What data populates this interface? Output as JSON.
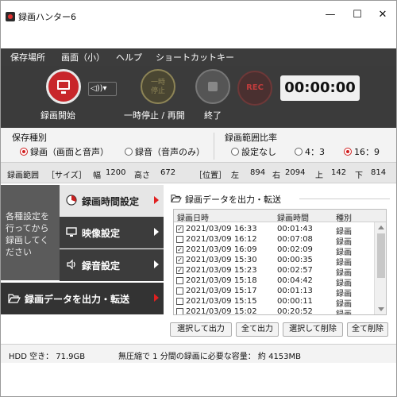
{
  "window": {
    "title": "録画ハンター6",
    "minimize": "—",
    "maximize": "☐",
    "close": "✕"
  },
  "menu": [
    "保存場所",
    "画面（小）",
    "ヘルプ",
    "ショートカットキー"
  ],
  "toolbar": {
    "record_label": "録画開始",
    "speaker": "◁))▾",
    "pause_icon_text": "一時\n停止",
    "pause_label": "一時停止 / 再開",
    "stop_label": "終了",
    "rec_text": "REC",
    "timer": "00:00:00"
  },
  "save_type": {
    "title": "保存種別",
    "options": [
      "録画（画面と音声）",
      "録音（音声のみ）"
    ],
    "selected": 0
  },
  "ratio": {
    "title": "録画範囲比率",
    "options": [
      "設定なし",
      "4：3",
      "16：9"
    ],
    "selected": 2
  },
  "range": {
    "label": "録画範囲",
    "size_label": "［サイズ］",
    "width_label": "幅",
    "width": "1200",
    "height_label": "高さ",
    "height": "672",
    "pos_label": "［位置］",
    "left_label": "左",
    "left": "894",
    "right_label": "右",
    "right": "2094",
    "top_label": "上",
    "top": "142",
    "bottom_label": "下",
    "bottom": "814"
  },
  "left_note": "各種設定を行ってから録画してください",
  "nav": [
    {
      "label": "録画時間設定"
    },
    {
      "label": "映像設定"
    },
    {
      "label": "録音設定"
    }
  ],
  "export_nav": "録画データを出力・転送",
  "export_panel": {
    "title": "録画データを出力・転送",
    "columns": [
      "録画日時",
      "録画時間",
      "種別"
    ],
    "rows": [
      {
        "checked": true,
        "datetime": "2021/03/09 16:33",
        "duration": "00:01:43",
        "type": "録画"
      },
      {
        "checked": false,
        "datetime": "2021/03/09 16:12",
        "duration": "00:07:08",
        "type": "録画"
      },
      {
        "checked": true,
        "datetime": "2021/03/09 16:09",
        "duration": "00:02:09",
        "type": "録画"
      },
      {
        "checked": true,
        "datetime": "2021/03/09 15:30",
        "duration": "00:00:35",
        "type": "録画"
      },
      {
        "checked": true,
        "datetime": "2021/03/09 15:23",
        "duration": "00:02:57",
        "type": "録画"
      },
      {
        "checked": false,
        "datetime": "2021/03/09 15:18",
        "duration": "00:04:42",
        "type": "録画"
      },
      {
        "checked": false,
        "datetime": "2021/03/09 15:17",
        "duration": "00:01:13",
        "type": "録画"
      },
      {
        "checked": false,
        "datetime": "2021/03/09 15:15",
        "duration": "00:00:11",
        "type": "録画"
      },
      {
        "checked": false,
        "datetime": "2021/03/09 15:02",
        "duration": "00:20:52",
        "type": "録画"
      }
    ],
    "buttons": [
      "選択して出力",
      "全て出力",
      "選択して削除",
      "全て削除"
    ]
  },
  "status": {
    "hdd": "HDD 空き： 71.9GB",
    "estimate": "無圧縮で 1 分間の録画に必要な容量： 約 4153MB"
  },
  "colors": {
    "accent_red": "#d02020",
    "dark_bg": "#3b3b3b"
  }
}
